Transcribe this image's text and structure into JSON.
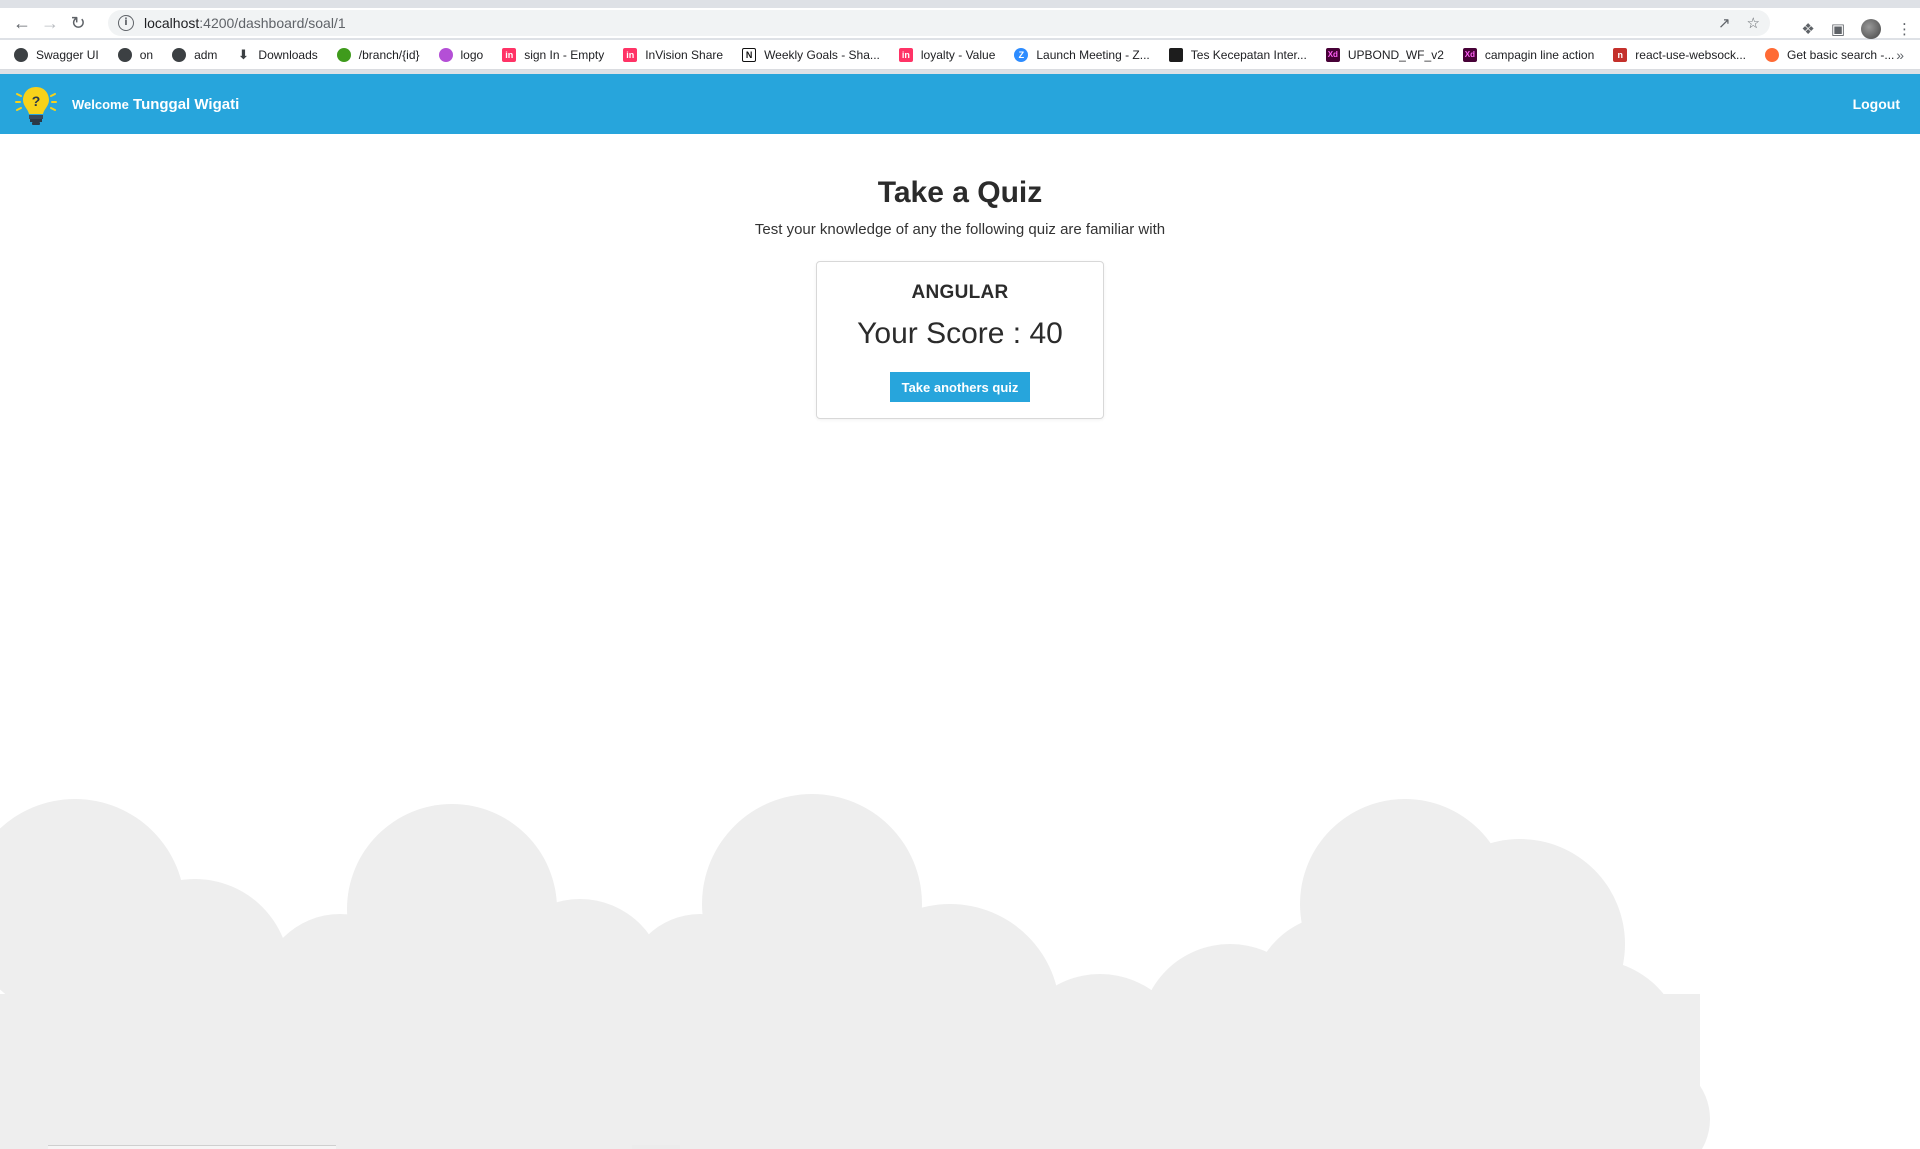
{
  "browser": {
    "url_host": "localhost",
    "url_path": ":4200/dashboard/soal/1",
    "bookmarks": [
      {
        "label": "Swagger UI",
        "icon": "globe-icon"
      },
      {
        "label": "on",
        "icon": "globe-icon"
      },
      {
        "label": "adm",
        "icon": "globe-icon"
      },
      {
        "label": "Downloads",
        "icon": "download-icon"
      },
      {
        "label": "/branch/{id}",
        "icon": "green-circle-icon"
      },
      {
        "label": "logo",
        "icon": "purple-logo-icon"
      },
      {
        "label": "sign In - Empty",
        "icon": "invision-icon"
      },
      {
        "label": "InVision Share",
        "icon": "invision-icon"
      },
      {
        "label": "Weekly Goals - Sha...",
        "icon": "notion-icon"
      },
      {
        "label": "loyalty - Value",
        "icon": "invision-icon"
      },
      {
        "label": "Launch Meeting - Z...",
        "icon": "zoom-icon"
      },
      {
        "label": "Tes Kecepatan Inter...",
        "icon": "speedtest-icon"
      },
      {
        "label": "UPBOND_WF_v2",
        "icon": "xd-icon"
      },
      {
        "label": "campagin line action",
        "icon": "xd-icon"
      },
      {
        "label": "react-use-websock...",
        "icon": "red-square-icon"
      },
      {
        "label": "Get basic search -...",
        "icon": "orange-circle-icon"
      }
    ]
  },
  "header": {
    "welcome_label": "Welcome",
    "user_name": "Tunggal Wigati",
    "logout_label": "Logout",
    "brand_color": "#27a5dc"
  },
  "main": {
    "title": "Take a Quiz",
    "subtitle": "Test your knowledge of any the following quiz are familiar with",
    "card": {
      "quiz_name": "ANGULAR",
      "score_text": "Your Score : 40",
      "button_label": "Take anothers quiz"
    }
  }
}
